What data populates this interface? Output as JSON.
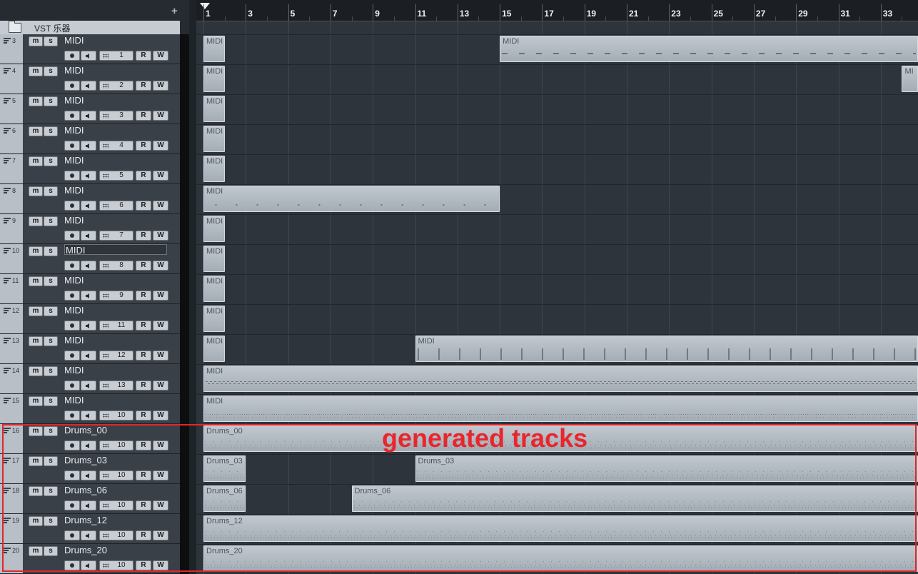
{
  "header": {
    "add_button": "+",
    "folder_label": "VST 乐器"
  },
  "tracks": [
    {
      "num": "3",
      "name": "MIDI",
      "channel": "1",
      "mute": "m",
      "solo": "s",
      "read": "R",
      "write": "W"
    },
    {
      "num": "4",
      "name": "MIDI",
      "channel": "2",
      "mute": "m",
      "solo": "s",
      "read": "R",
      "write": "W"
    },
    {
      "num": "5",
      "name": "MIDI",
      "channel": "3",
      "mute": "m",
      "solo": "s",
      "read": "R",
      "write": "W"
    },
    {
      "num": "6",
      "name": "MIDI",
      "channel": "4",
      "mute": "m",
      "solo": "s",
      "read": "R",
      "write": "W"
    },
    {
      "num": "7",
      "name": "MIDI",
      "channel": "5",
      "mute": "m",
      "solo": "s",
      "read": "R",
      "write": "W"
    },
    {
      "num": "8",
      "name": "MIDI",
      "channel": "6",
      "mute": "m",
      "solo": "s",
      "read": "R",
      "write": "W"
    },
    {
      "num": "9",
      "name": "MIDI",
      "channel": "7",
      "mute": "m",
      "solo": "s",
      "read": "R",
      "write": "W"
    },
    {
      "num": "10",
      "name": "MIDI",
      "channel": "8",
      "mute": "m",
      "solo": "s",
      "read": "R",
      "write": "W",
      "selected": true
    },
    {
      "num": "11",
      "name": "MIDI",
      "channel": "9",
      "mute": "m",
      "solo": "s",
      "read": "R",
      "write": "W"
    },
    {
      "num": "12",
      "name": "MIDI",
      "channel": "11",
      "mute": "m",
      "solo": "s",
      "read": "R",
      "write": "W"
    },
    {
      "num": "13",
      "name": "MIDI",
      "channel": "12",
      "mute": "m",
      "solo": "s",
      "read": "R",
      "write": "W"
    },
    {
      "num": "14",
      "name": "MIDI",
      "channel": "13",
      "mute": "m",
      "solo": "s",
      "read": "R",
      "write": "W"
    },
    {
      "num": "15",
      "name": "MIDI",
      "channel": "10",
      "mute": "m",
      "solo": "s",
      "read": "R",
      "write": "W"
    },
    {
      "num": "16",
      "name": "Drums_00",
      "channel": "10",
      "mute": "m",
      "solo": "s",
      "read": "R",
      "write": "W"
    },
    {
      "num": "17",
      "name": "Drums_03",
      "channel": "10",
      "mute": "m",
      "solo": "s",
      "read": "R",
      "write": "W"
    },
    {
      "num": "18",
      "name": "Drums_06",
      "channel": "10",
      "mute": "m",
      "solo": "s",
      "read": "R",
      "write": "W"
    },
    {
      "num": "19",
      "name": "Drums_12",
      "channel": "10",
      "mute": "m",
      "solo": "s",
      "read": "R",
      "write": "W"
    },
    {
      "num": "20",
      "name": "Drums_20",
      "channel": "10",
      "mute": "m",
      "solo": "s",
      "read": "R",
      "write": "W"
    }
  ],
  "ruler": {
    "bars": [
      "1",
      "3",
      "5",
      "7",
      "9",
      "11",
      "13",
      "15",
      "17",
      "19",
      "21",
      "23",
      "25",
      "27",
      "29",
      "31",
      "33"
    ]
  },
  "parts": [
    {
      "track": 0,
      "start": 1,
      "end": 2,
      "label": "MIDI",
      "pattern": "none"
    },
    {
      "track": 0,
      "start": 15,
      "end": 35,
      "label": "MIDI",
      "pattern": "sparse"
    },
    {
      "track": 1,
      "start": 1,
      "end": 2,
      "label": "MIDI",
      "pattern": "none"
    },
    {
      "track": 1,
      "start": 34,
      "end": 35,
      "label": "MI",
      "pattern": "none"
    },
    {
      "track": 2,
      "start": 1,
      "end": 2,
      "label": "MIDI",
      "pattern": "none"
    },
    {
      "track": 3,
      "start": 1,
      "end": 2,
      "label": "MIDI",
      "pattern": "none"
    },
    {
      "track": 4,
      "start": 1,
      "end": 2,
      "label": "MIDI",
      "pattern": "none"
    },
    {
      "track": 5,
      "start": 1,
      "end": 15,
      "label": "MIDI",
      "pattern": "dots"
    },
    {
      "track": 6,
      "start": 1,
      "end": 2,
      "label": "MIDI",
      "pattern": "none"
    },
    {
      "track": 7,
      "start": 1,
      "end": 2,
      "label": "MIDI",
      "pattern": "none"
    },
    {
      "track": 8,
      "start": 1,
      "end": 2,
      "label": "MIDI",
      "pattern": "none"
    },
    {
      "track": 9,
      "start": 1,
      "end": 2,
      "label": "MIDI",
      "pattern": "none"
    },
    {
      "track": 10,
      "start": 1,
      "end": 2,
      "label": "MIDI",
      "pattern": "none"
    },
    {
      "track": 10,
      "start": 11,
      "end": 35,
      "label": "MIDI",
      "pattern": "cols"
    },
    {
      "track": 11,
      "start": 1,
      "end": 35,
      "label": "MIDI",
      "pattern": "wave"
    },
    {
      "track": 12,
      "start": 1,
      "end": 35,
      "label": "MIDI",
      "pattern": "dense"
    },
    {
      "track": 13,
      "start": 1,
      "end": 35,
      "label": "Drums_00",
      "pattern": "drum"
    },
    {
      "track": 14,
      "start": 1,
      "end": 3,
      "label": "Drums_03",
      "pattern": "drum"
    },
    {
      "track": 14,
      "start": 11,
      "end": 35,
      "label": "Drums_03",
      "pattern": "drum"
    },
    {
      "track": 15,
      "start": 1,
      "end": 3,
      "label": "Drums_06",
      "pattern": "drum"
    },
    {
      "track": 15,
      "start": 8,
      "end": 35,
      "label": "Drums_06",
      "pattern": "drum"
    },
    {
      "track": 16,
      "start": 1,
      "end": 35,
      "label": "Drums_12",
      "pattern": "drum"
    },
    {
      "track": 17,
      "start": 1,
      "end": 35,
      "label": "Drums_20",
      "pattern": "drum"
    }
  ],
  "annotation": {
    "text": "generated tracks",
    "color": "#e8262c"
  }
}
